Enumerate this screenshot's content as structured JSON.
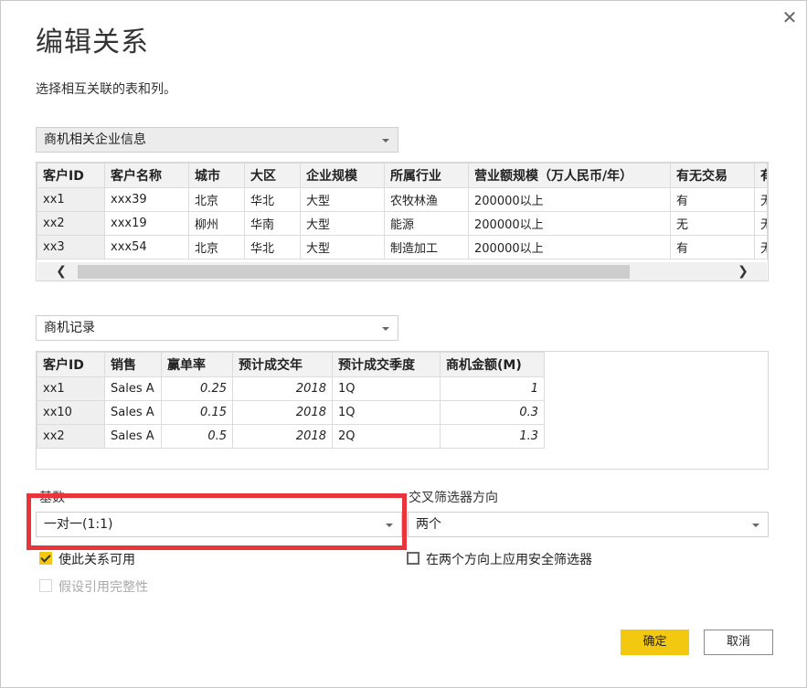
{
  "dialog": {
    "title": "编辑关系",
    "subtitle": "选择相互关联的表和列。",
    "close_glyph": "✕"
  },
  "table1": {
    "selected": "商机相关企业信息",
    "columns": [
      "客户ID",
      "客户名称",
      "城市",
      "大区",
      "企业规模",
      "所属行业",
      "营业额规模（万人民币/年）",
      "有无交易",
      "有"
    ],
    "rows": [
      [
        "xx1",
        "xxx39",
        "北京",
        "华北",
        "大型",
        "农牧林渔",
        "200000以上",
        "有",
        "无"
      ],
      [
        "xx2",
        "xxx19",
        "柳州",
        "华南",
        "大型",
        "能源",
        "200000以上",
        "无",
        "无"
      ],
      [
        "xx3",
        "xxx54",
        "北京",
        "华北",
        "大型",
        "制造加工",
        "200000以上",
        "有",
        "无"
      ]
    ],
    "scroll_left": "❮",
    "scroll_right": "❯"
  },
  "table2": {
    "selected": "商机记录",
    "columns": [
      "客户ID",
      "销售",
      "赢单率",
      "预计成交年",
      "预计成交季度",
      "商机金额(M)"
    ],
    "rows": [
      [
        "xx1",
        "Sales A",
        "0.25",
        "2018",
        "1Q",
        "1"
      ],
      [
        "xx10",
        "Sales A",
        "0.15",
        "2018",
        "1Q",
        "0.3"
      ],
      [
        "xx2",
        "Sales A",
        "0.5",
        "2018",
        "2Q",
        "1.3"
      ]
    ]
  },
  "cardinality": {
    "label": "基数",
    "selected": "一对一(1:1)"
  },
  "cross_filter": {
    "label": "交叉筛选器方向",
    "selected": "两个"
  },
  "options": {
    "make_active": {
      "label": "使此关系可用",
      "checked": true
    },
    "assume_integrity": {
      "label": "假设引用完整性",
      "checked": false,
      "disabled": true
    },
    "security_filter": {
      "label": "在两个方向上应用安全筛选器",
      "checked": false
    }
  },
  "buttons": {
    "ok": "确定",
    "cancel": "取消"
  },
  "colors": {
    "accent": "#f2c811",
    "highlight": "#e8343a"
  }
}
